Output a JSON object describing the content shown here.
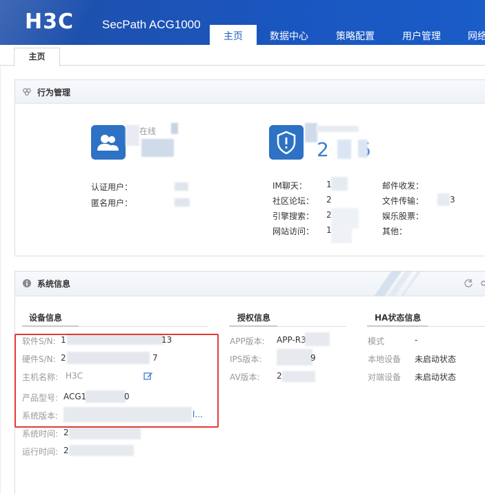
{
  "header": {
    "logo": "H3C",
    "product": "SecPath ACG1000",
    "nav": [
      {
        "label": "主页",
        "active": true
      },
      {
        "label": "数据中心",
        "active": false
      },
      {
        "label": "策略配置",
        "active": false
      },
      {
        "label": "用户管理",
        "active": false
      },
      {
        "label": "网络",
        "active": false
      }
    ]
  },
  "tabs": {
    "home": "主页"
  },
  "behavior": {
    "title": "行为管理",
    "online_label": "在线",
    "counter_value": "2 0 5",
    "user_labels": [
      "认证用户：",
      "匿名用户："
    ],
    "traffic_left": [
      {
        "label": "IM聊天：",
        "value": "1"
      },
      {
        "label": "社区论坛：",
        "value": "2"
      },
      {
        "label": "引擎搜索：",
        "value": "2"
      },
      {
        "label": "网站访问：",
        "value": "1"
      }
    ],
    "traffic_right": [
      {
        "label": "邮件收发：",
        "value": ""
      },
      {
        "label": "文件传输：",
        "value": "3"
      },
      {
        "label": "娱乐股票：",
        "value": ""
      },
      {
        "label": "其他：",
        "value": ""
      }
    ]
  },
  "system": {
    "title": "系统信息",
    "device_info": {
      "heading": "设备信息",
      "rows": [
        {
          "label": "软件S/N:",
          "value": "1",
          "tail": "13"
        },
        {
          "label": "硬件S/N:",
          "value": "2",
          "tail": "7"
        },
        {
          "label": "主机名称:",
          "value": "H3C",
          "tail": ""
        },
        {
          "label": "产品型号:",
          "value": "ACG1",
          "tail": "0"
        },
        {
          "label": "系统版本:",
          "value": "",
          "tail": "l..."
        },
        {
          "label": "系统时间:",
          "value": "2",
          "tail": ""
        },
        {
          "label": "运行时间:",
          "value": "2",
          "tail": ""
        }
      ]
    },
    "license_info": {
      "heading": "授权信息",
      "rows": [
        {
          "label": "APP版本:",
          "value": "APP-R3"
        },
        {
          "label": "IPS版本:",
          "value": ""
        },
        {
          "label": "AV版本:",
          "value": "2"
        }
      ],
      "ips_tail": "9"
    },
    "ha_info": {
      "heading": "HA状态信息",
      "rows": [
        {
          "label": "模式",
          "value": "-"
        },
        {
          "label": "本地设备",
          "value": "未启动状态"
        },
        {
          "label": "对端设备",
          "value": "未启动状态"
        }
      ]
    }
  },
  "colors": {
    "brand": "#1a5cc0",
    "highlight_box": "#e53935"
  }
}
